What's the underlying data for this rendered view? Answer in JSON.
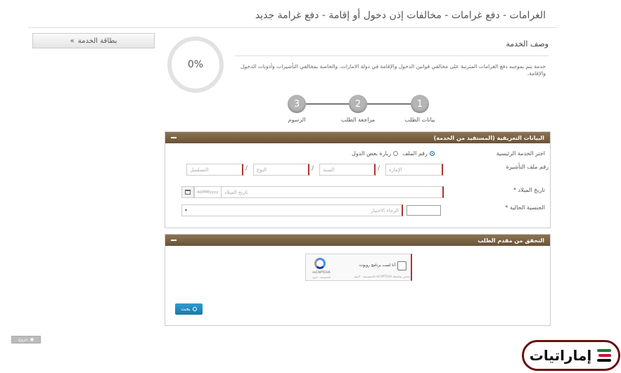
{
  "header": {
    "title": "الغرامات - دفع غرامات - مخالفات إذن دخول أو إقامة - دفع غرامة جديد"
  },
  "service_card": {
    "label": "بطاقة الخدمة",
    "icon": "double-chevron-right-icon"
  },
  "progress": {
    "value": 0,
    "label": "0%"
  },
  "description": {
    "title": "وصف الخدمة",
    "text": "خدمة يتم بموجبه دفع الغرامات المترتبة على مخالفي قوانين الدخول والإقامة في دولة الامارات، والخاصة بمخالفي التأشيرات وأذونات الدخول والإقامة."
  },
  "steps": [
    {
      "number": "1",
      "label": "بيانات الطلب"
    },
    {
      "number": "2",
      "label": "مراجعة الطلب"
    },
    {
      "number": "3",
      "label": "الرسوم"
    }
  ],
  "beneficiary_panel": {
    "title": "البيانات التعريفية (المستفيد من الخدمة)",
    "main_service_label": "اختر الخدمة الرئيسية",
    "options": [
      {
        "label": "رقم الملف",
        "selected": true
      },
      {
        "label": "زيارة بعض الدول",
        "selected": false
      }
    ],
    "visa_file_label": "رقم ملف التأشيرة",
    "visa_fields": [
      "الإمارة",
      "السنة",
      "النوع",
      "التسلسل"
    ],
    "birth_date_label": "تاريخ الميلاد *",
    "birth_date_placeholder": "تاريخ الميلاد",
    "date_format": "dd/MM/yyyy",
    "nationality_label": "الجنسية الحالية *",
    "nationality_placeholder": "الرجاء الاختيار"
  },
  "verify_panel": {
    "title": "التحقق من مقدم الطلب",
    "recaptcha": {
      "checkbox_label": "أنا لست برنامج روبوت",
      "brand": "reCAPTCHA",
      "terms": "الخصوصية - البنود",
      "footer": "محمي بواسطة reCAPTCHA الخصوصية - البنود"
    }
  },
  "search_button": {
    "label": "بحث"
  },
  "small_button": {
    "label": "خروج"
  },
  "logo": {
    "text": "إماراتيات"
  },
  "colors": {
    "panel_header": "#7a6144",
    "accent_blue": "#2a8dc4",
    "required_red": "#b03030",
    "logo_border": "#6b1010"
  }
}
